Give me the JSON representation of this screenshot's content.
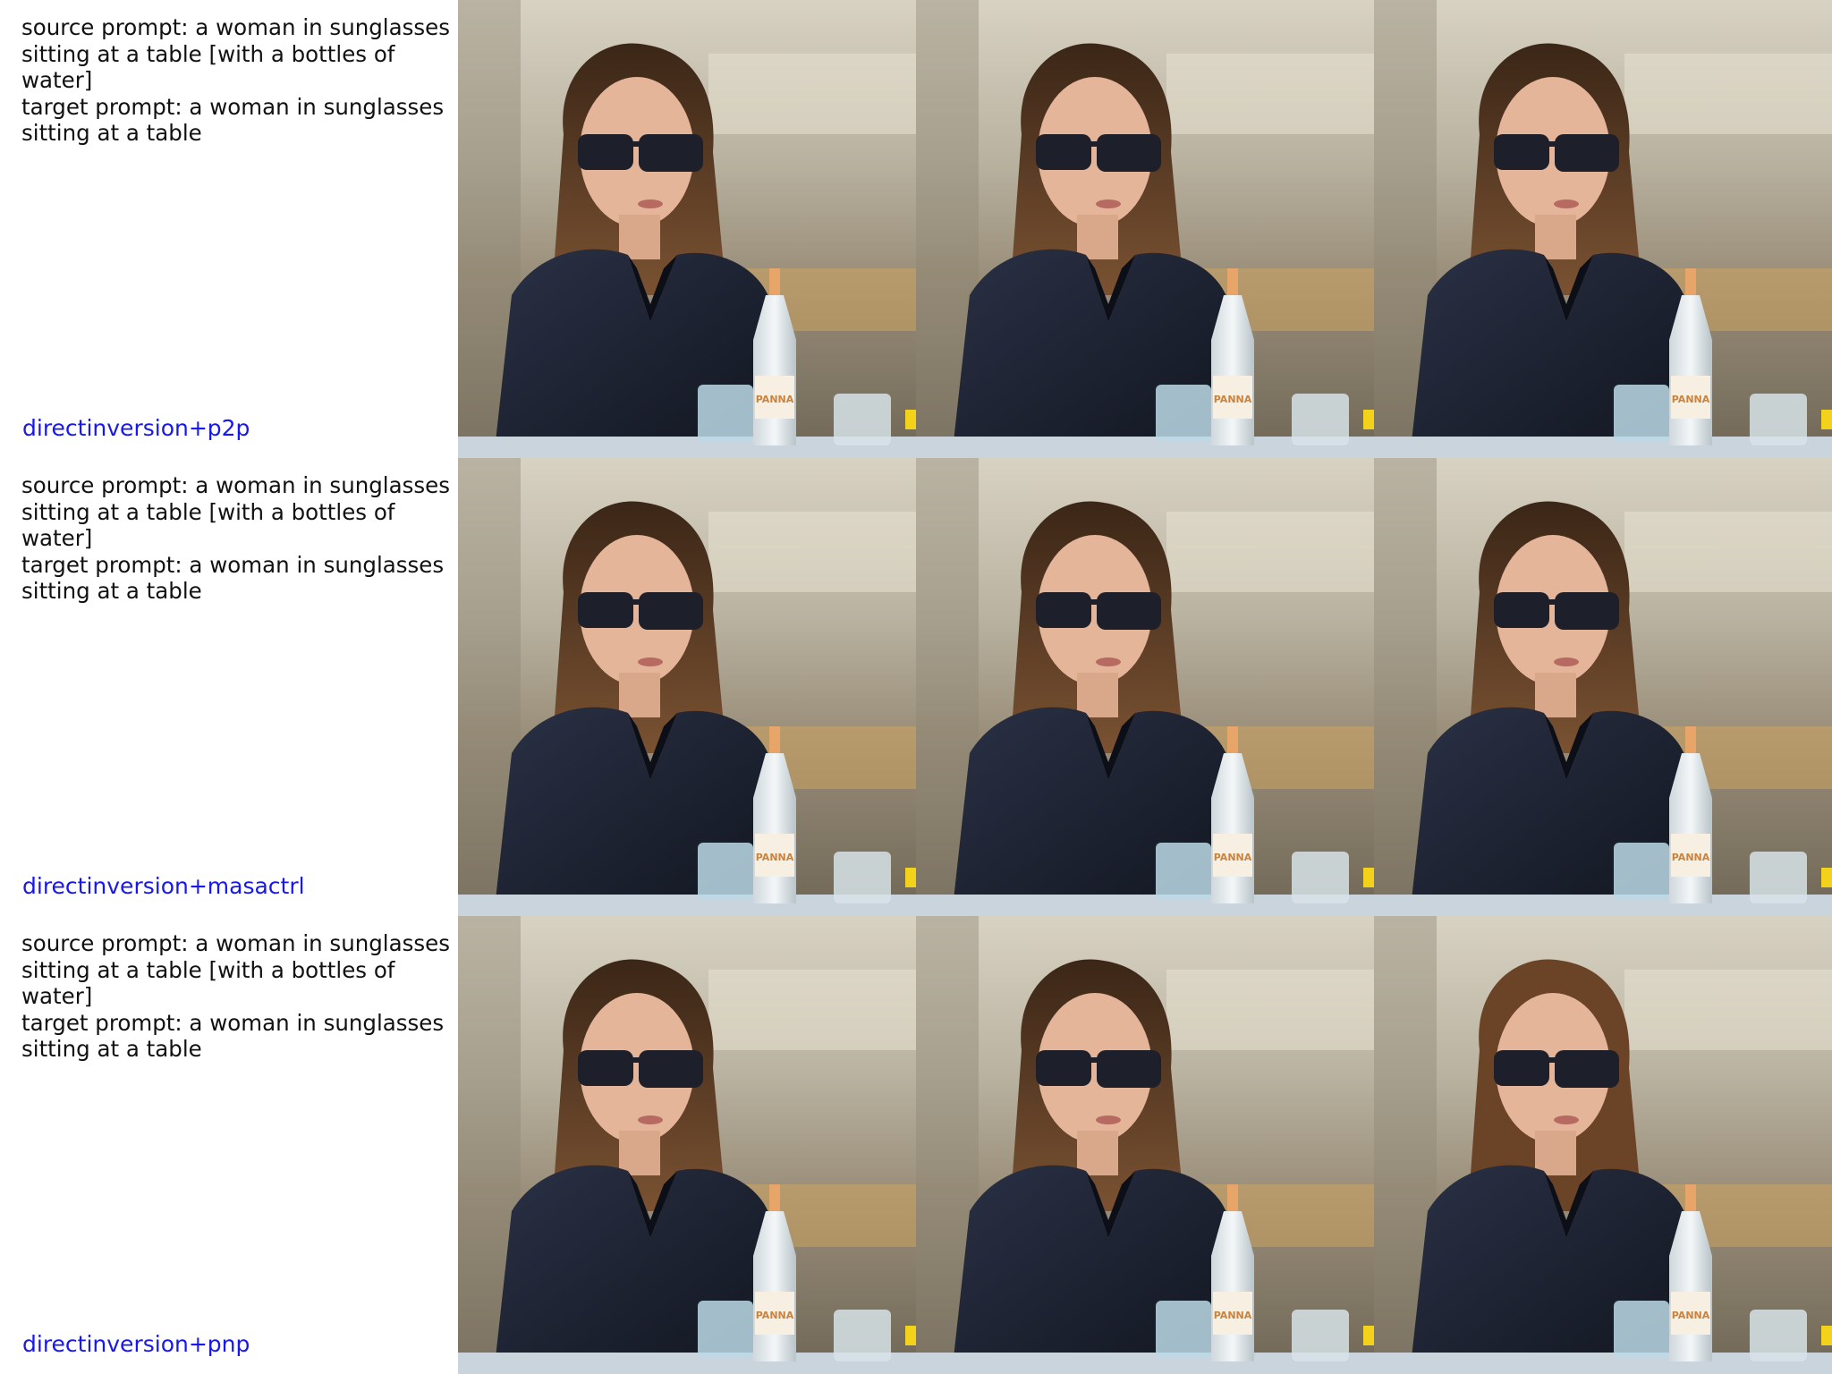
{
  "rows": [
    {
      "source_prompt": "source prompt: a woman in sunglasses sitting at a table [with a bottles of water]",
      "target_prompt": "target prompt: a woman in sunglasses sitting at a table",
      "method": "directinversion+p2p"
    },
    {
      "source_prompt": "source prompt: a woman in sunglasses sitting at a table [with a bottles of water]",
      "target_prompt": "target prompt: a woman in sunglasses sitting at a table",
      "method": "directinversion+masactrl"
    },
    {
      "source_prompt": "source prompt: a woman in sunglasses sitting at a table [with a bottles of water]",
      "target_prompt": "target prompt: a woman in sunglasses sitting at a table",
      "method": "directinversion+pnp"
    }
  ],
  "bottle_label": "PANNA",
  "colors": {
    "method_label": "#1717f0",
    "jacket": "#1c2233",
    "hair": "#5a3a22",
    "background": "#cbbfa6"
  }
}
